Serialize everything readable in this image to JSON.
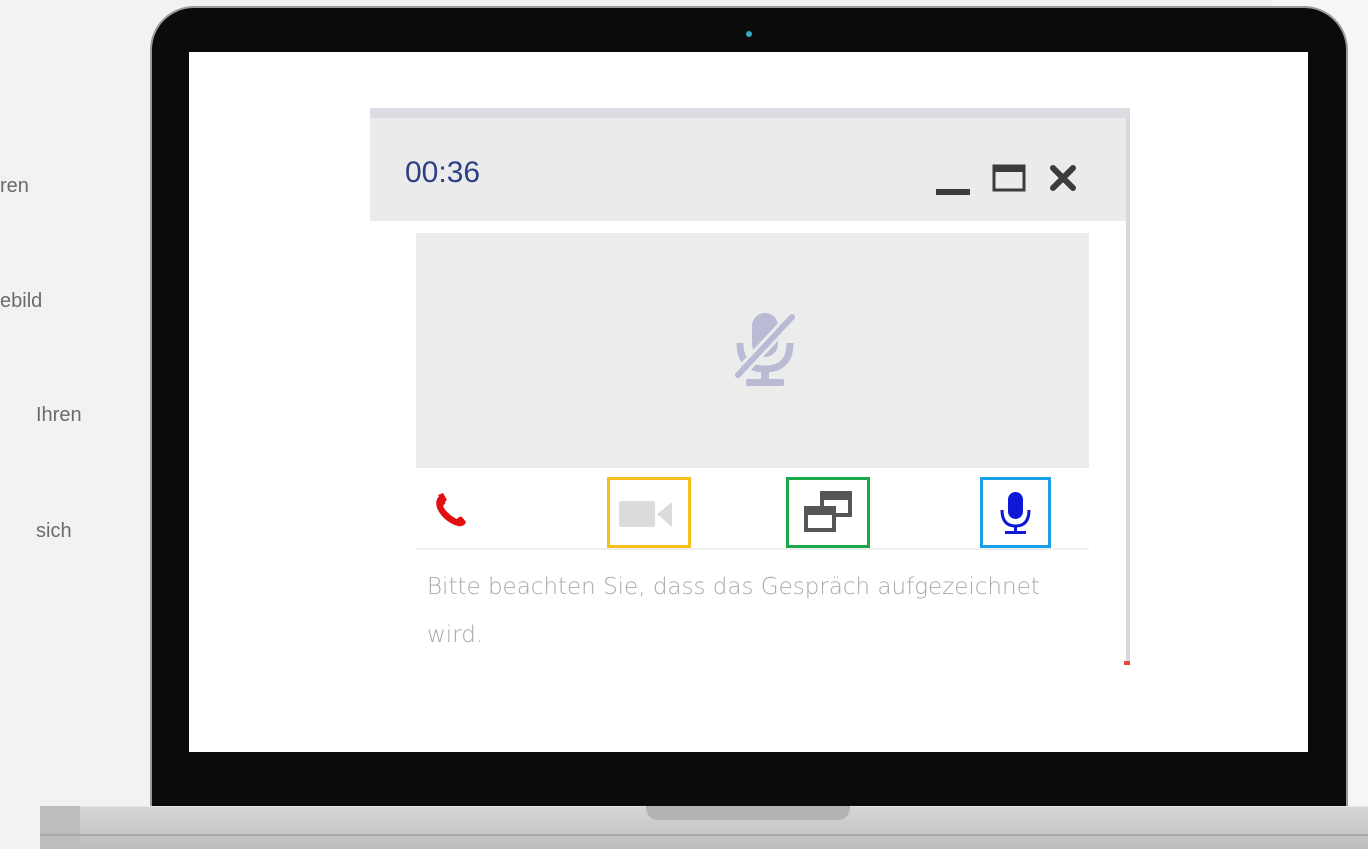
{
  "background_text": {
    "line1": "ren",
    "line2": "ebild",
    "line3": "Ihren",
    "line4": "sich"
  },
  "call_widget": {
    "timer": "00:36",
    "window_buttons": [
      "minimize-icon",
      "maximize-icon",
      "close-icon"
    ],
    "video_area_icon": "microphone-muted-icon",
    "controls": [
      {
        "name": "hangup-button",
        "icon": "phone-icon",
        "color": "#e01010"
      },
      {
        "name": "camera-toggle-button",
        "icon": "video-camera-icon",
        "color": "#dcdcdc",
        "highlight": "#f4c21a"
      },
      {
        "name": "popout-window-button",
        "icon": "window-restore-icon",
        "color": "#555555",
        "highlight": "#1aa84a"
      },
      {
        "name": "microphone-button",
        "icon": "microphone-icon",
        "color": "#1018d8",
        "highlight": "#1aa0e6"
      }
    ],
    "notice": "Bitte beachten Sie, dass das Gespräch aufgezeichnet wird."
  },
  "colors": {
    "timer": "#2e3f86",
    "header_bg": "#ebebec",
    "video_bg": "#ececec",
    "muted_icon": "#b8bbd3"
  }
}
